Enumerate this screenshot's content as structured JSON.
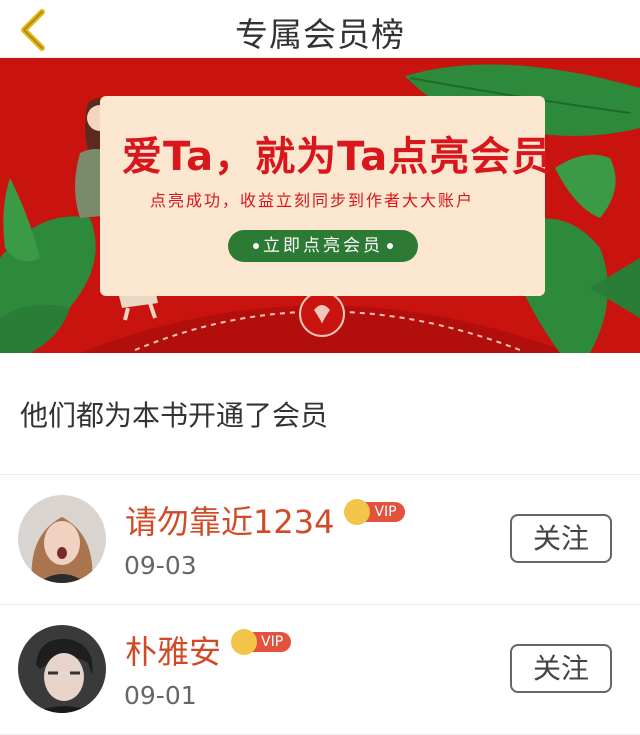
{
  "header": {
    "title": "专属会员榜",
    "back_icon": "chevron-left-icon"
  },
  "banner": {
    "headline": "爱Ta，就为Ta点亮会员",
    "subtitle": "点亮成功，收益立刻同步到作者大大账户",
    "cta_label": "立即点亮会员",
    "colors": {
      "background": "#c8130f",
      "card": "#fbe6d0",
      "cta": "#2d7a35"
    }
  },
  "section": {
    "title": "他们都为本书开通了会员"
  },
  "members": [
    {
      "name": "请勿靠近1234",
      "date": "09-03",
      "badge": "VIP",
      "follow_label": "关注"
    },
    {
      "name": "朴雅安",
      "date": "09-01",
      "badge": "VIP",
      "follow_label": "关注"
    }
  ],
  "colors": {
    "accent": "#d24a25",
    "vip": "#e2523d",
    "crown": "#f2c447"
  }
}
